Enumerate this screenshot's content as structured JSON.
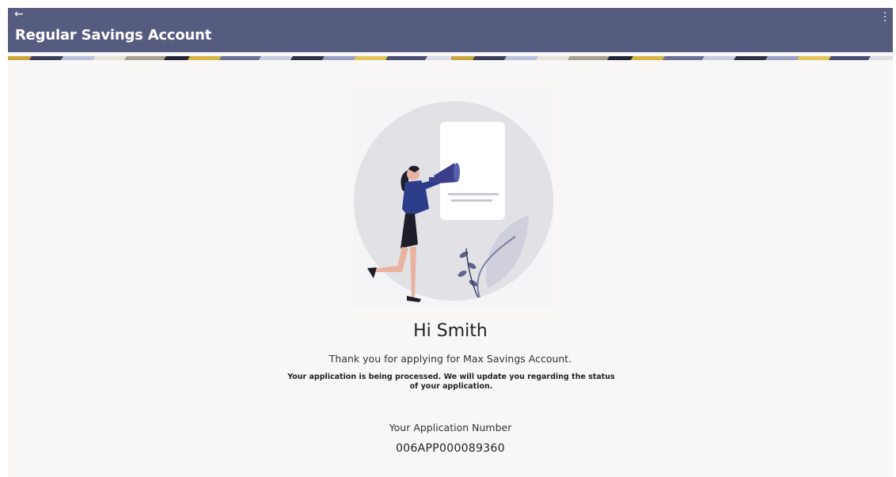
{
  "header": {
    "back_icon": "←",
    "title": "Regular Savings Account",
    "menu_icon": "kebab-menu"
  },
  "colors": {
    "header_bg": "#565b80",
    "page_bg": "#f8f7f6"
  },
  "confirmation": {
    "greeting": "Hi Smith",
    "thanks": "Thank you for applying for Max Savings Account.",
    "processing": "Your application is being processed. We will update you regarding the status of your application.",
    "application_number_label": "Your Application Number",
    "application_number": "006APP000089360"
  }
}
